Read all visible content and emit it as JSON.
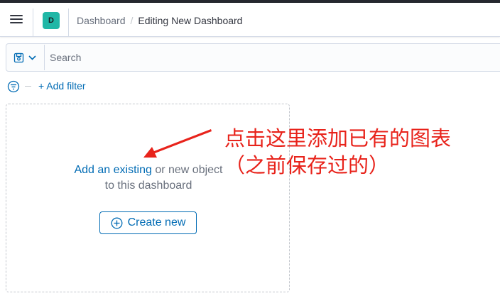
{
  "header": {
    "avatar_letter": "D",
    "breadcrumb": {
      "parent": "Dashboard",
      "separator": "/",
      "current": "Editing New Dashboard"
    }
  },
  "querybar": {
    "placeholder": "Search"
  },
  "filterbar": {
    "add_filter": "+ Add filter"
  },
  "empty_panel": {
    "link_text": "Add an existing",
    "text_rest": " or new object",
    "text_line2": "to this dashboard",
    "create_button": "Create new"
  },
  "annotation": {
    "line1": "点击这里添加已有的图表",
    "line2": "（之前保存过的）",
    "color": "#e8231b"
  },
  "colors": {
    "link": "#006bb4",
    "avatar": "#20b7a6"
  }
}
